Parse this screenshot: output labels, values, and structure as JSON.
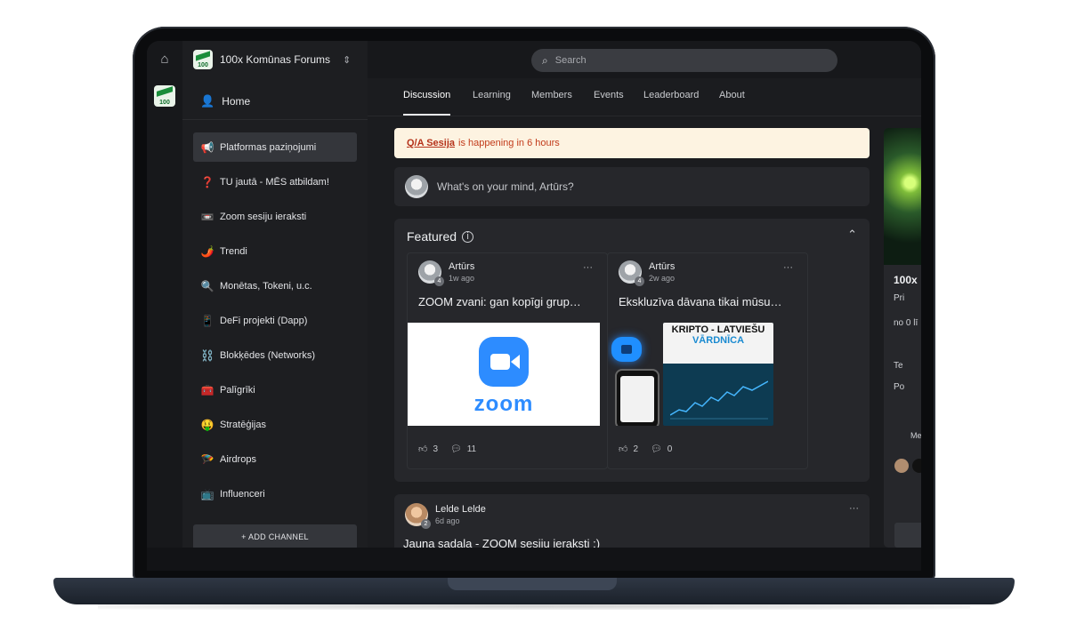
{
  "community": {
    "name": "100x Komūnas Forums",
    "logo_text": "100"
  },
  "search": {
    "placeholder": "Search"
  },
  "sidebar": {
    "home_label": "Home",
    "channels": [
      {
        "emoji": "📢",
        "label": "Platformas paziņojumi",
        "active": true
      },
      {
        "emoji": "❓",
        "label": "TU jautā - MĒS atbildam!"
      },
      {
        "emoji": "📼",
        "label": "Zoom sesiju ieraksti"
      },
      {
        "emoji": "🌶️",
        "label": "Trendi"
      },
      {
        "emoji": "🔍",
        "label": "Monētas, Tokeni, u.c."
      },
      {
        "emoji": "📱",
        "label": "DeFi projekti (Dapp)"
      },
      {
        "emoji": "⛓️",
        "label": "Blokķēdes (Networks)"
      },
      {
        "emoji": "🧰",
        "label": "Palīgrīki"
      },
      {
        "emoji": "🤑",
        "label": "Stratēģijas"
      },
      {
        "emoji": "🪂",
        "label": "Airdrops"
      },
      {
        "emoji": "📺",
        "label": "Influenceri"
      }
    ],
    "add_channel_label": "+ ADD CHANNEL"
  },
  "tabs": [
    "Discussion",
    "Learning",
    "Members",
    "Events",
    "Leaderboard",
    "About"
  ],
  "alert": {
    "link": "Q/A Sesija",
    "text": "is happening in 6 hours"
  },
  "composer": {
    "placeholder": "What's on your mind, Artūrs?"
  },
  "featured": {
    "title": "Featured",
    "posts": [
      {
        "author": "Artūrs",
        "level": "4",
        "time": "1w ago",
        "title": "ZOOM zvani: gan kopīgi grup…",
        "likes": "3",
        "comments": "11",
        "media_text": "zoom"
      },
      {
        "author": "Artūrs",
        "level": "4",
        "time": "2w ago",
        "title": "Ekskluzīva dāvana tikai mūsu…",
        "likes": "2",
        "comments": "0",
        "media_title": "KRIPTO - LATVIEŠU",
        "media_subtitle": "VĀRDNĪCA"
      }
    ]
  },
  "post": {
    "author": "Lelde Lelde",
    "level": "2",
    "time": "6d ago",
    "title": "Jauna sadaļa - ZOOM sesiju ieraksti :)"
  },
  "right_panel": {
    "title": "100x",
    "line1": "Pri",
    "line2": "no 0 lī",
    "link1": "Te",
    "link2": "Po",
    "members": "Me"
  },
  "colors": {
    "screen_bg": "#1b1c1f",
    "card_bg": "#26272b",
    "alert_bg": "#fdf3e1",
    "alert_text": "#c23b1a",
    "zoom_blue": "#2d8cff"
  }
}
